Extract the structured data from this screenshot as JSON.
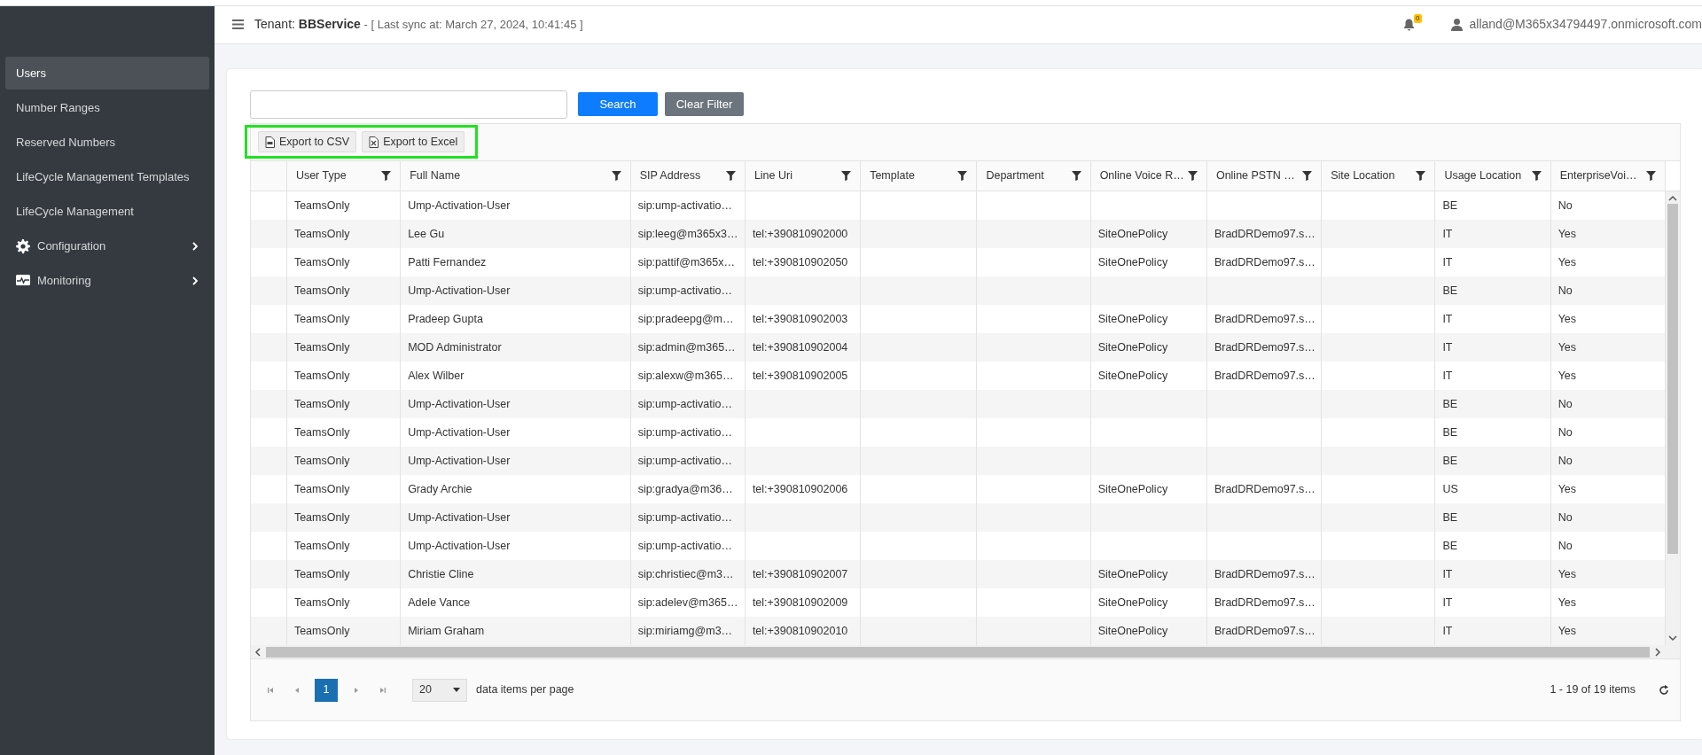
{
  "sidebar": {
    "items": [
      {
        "label": "Users",
        "kind": "link",
        "selected": true
      },
      {
        "label": "Number Ranges",
        "kind": "link",
        "selected": false
      },
      {
        "label": "Reserved Numbers",
        "kind": "link",
        "selected": false
      },
      {
        "label": "LifeCycle Management Templates",
        "kind": "link",
        "selected": false
      },
      {
        "label": "LifeCycle Management",
        "kind": "link",
        "selected": false
      },
      {
        "label": "Configuration",
        "kind": "settings",
        "selected": false,
        "expanded": false
      },
      {
        "label": "Monitoring",
        "kind": "monitoring",
        "selected": false,
        "expanded": false
      }
    ]
  },
  "header": {
    "tenant_label": "Tenant:",
    "tenant": "BBService",
    "sync": "- [ Last sync at: March 27, 2024, 10:41:45 ]",
    "notification_count": "0",
    "user": "alland@M365x34794497.onmicrosoft.com"
  },
  "filter": {
    "search_button": "Search",
    "clear_button": "Clear Filter"
  },
  "toolbar": {
    "highlighted": true,
    "buttons": [
      {
        "label": "Export to CSV",
        "kind": "csv"
      },
      {
        "label": "Export to Excel",
        "kind": "excel"
      }
    ]
  },
  "table": {
    "columns": [
      "User Type",
      "Full Name",
      "SIP Address",
      "Line Uri",
      "Template",
      "Department",
      "Online Voice R…",
      "Online PSTN …",
      "Site Location",
      "Usage Location",
      "EnterpriseVoi…"
    ],
    "rows": [
      {
        "user_type": "TeamsOnly",
        "full_name": "Ump-Activation-User",
        "sip_address": "sip:ump-activatio…",
        "usage_location": "BE",
        "enterprise_voice": "No"
      },
      {
        "user_type": "TeamsOnly",
        "full_name": "Lee Gu",
        "sip_address": "sip:leeg@m365x3…",
        "line_uri": "tel:+390810902000",
        "online_voice_routing": "SiteOnePolicy",
        "online_pstn": "BradDRDemo97.s…",
        "usage_location": "IT",
        "enterprise_voice": "Yes"
      },
      {
        "user_type": "TeamsOnly",
        "full_name": "Patti Fernandez",
        "sip_address": "sip:pattif@m365x…",
        "line_uri": "tel:+390810902050",
        "online_voice_routing": "SiteOnePolicy",
        "online_pstn": "BradDRDemo97.s…",
        "usage_location": "IT",
        "enterprise_voice": "Yes"
      },
      {
        "user_type": "TeamsOnly",
        "full_name": "Ump-Activation-User",
        "sip_address": "sip:ump-activatio…",
        "usage_location": "BE",
        "enterprise_voice": "No"
      },
      {
        "user_type": "TeamsOnly",
        "full_name": "Pradeep Gupta",
        "sip_address": "sip:pradeepg@m…",
        "line_uri": "tel:+390810902003",
        "online_voice_routing": "SiteOnePolicy",
        "online_pstn": "BradDRDemo97.s…",
        "usage_location": "IT",
        "enterprise_voice": "Yes"
      },
      {
        "user_type": "TeamsOnly",
        "full_name": "MOD Administrator",
        "sip_address": "sip:admin@m365…",
        "line_uri": "tel:+390810902004",
        "online_voice_routing": "SiteOnePolicy",
        "online_pstn": "BradDRDemo97.s…",
        "usage_location": "IT",
        "enterprise_voice": "Yes"
      },
      {
        "user_type": "TeamsOnly",
        "full_name": "Alex Wilber",
        "sip_address": "sip:alexw@m365…",
        "line_uri": "tel:+390810902005",
        "online_voice_routing": "SiteOnePolicy",
        "online_pstn": "BradDRDemo97.s…",
        "usage_location": "IT",
        "enterprise_voice": "Yes"
      },
      {
        "user_type": "TeamsOnly",
        "full_name": "Ump-Activation-User",
        "sip_address": "sip:ump-activatio…",
        "usage_location": "BE",
        "enterprise_voice": "No"
      },
      {
        "user_type": "TeamsOnly",
        "full_name": "Ump-Activation-User",
        "sip_address": "sip:ump-activatio…",
        "usage_location": "BE",
        "enterprise_voice": "No"
      },
      {
        "user_type": "TeamsOnly",
        "full_name": "Ump-Activation-User",
        "sip_address": "sip:ump-activatio…",
        "usage_location": "BE",
        "enterprise_voice": "No"
      },
      {
        "user_type": "TeamsOnly",
        "full_name": "Grady Archie",
        "sip_address": "sip:gradya@m36…",
        "line_uri": "tel:+390810902006",
        "online_voice_routing": "SiteOnePolicy",
        "online_pstn": "BradDRDemo97.s…",
        "usage_location": "US",
        "enterprise_voice": "Yes"
      },
      {
        "user_type": "TeamsOnly",
        "full_name": "Ump-Activation-User",
        "sip_address": "sip:ump-activatio…",
        "usage_location": "BE",
        "enterprise_voice": "No"
      },
      {
        "user_type": "TeamsOnly",
        "full_name": "Ump-Activation-User",
        "sip_address": "sip:ump-activatio…",
        "usage_location": "BE",
        "enterprise_voice": "No"
      },
      {
        "user_type": "TeamsOnly",
        "full_name": "Christie Cline",
        "sip_address": "sip:christiec@m3…",
        "line_uri": "tel:+390810902007",
        "online_voice_routing": "SiteOnePolicy",
        "online_pstn": "BradDRDemo97.s…",
        "usage_location": "IT",
        "enterprise_voice": "Yes"
      },
      {
        "user_type": "TeamsOnly",
        "full_name": "Adele Vance",
        "sip_address": "sip:adelev@m365…",
        "line_uri": "tel:+390810902009",
        "online_voice_routing": "SiteOnePolicy",
        "online_pstn": "BradDRDemo97.s…",
        "usage_location": "IT",
        "enterprise_voice": "Yes"
      },
      {
        "user_type": "TeamsOnly",
        "full_name": "Miriam Graham",
        "sip_address": "sip:miriamg@m3…",
        "line_uri": "tel:+390810902010",
        "online_voice_routing": "SiteOnePolicy",
        "online_pstn": "BradDRDemo97.s…",
        "usage_location": "IT",
        "enterprise_voice": "Yes"
      }
    ]
  },
  "pager": {
    "pages": [
      {
        "label": "1",
        "selected": true
      }
    ],
    "page_size": "20",
    "page_size_label": "data items per page",
    "summary": "1 - 19 of 19 items"
  }
}
